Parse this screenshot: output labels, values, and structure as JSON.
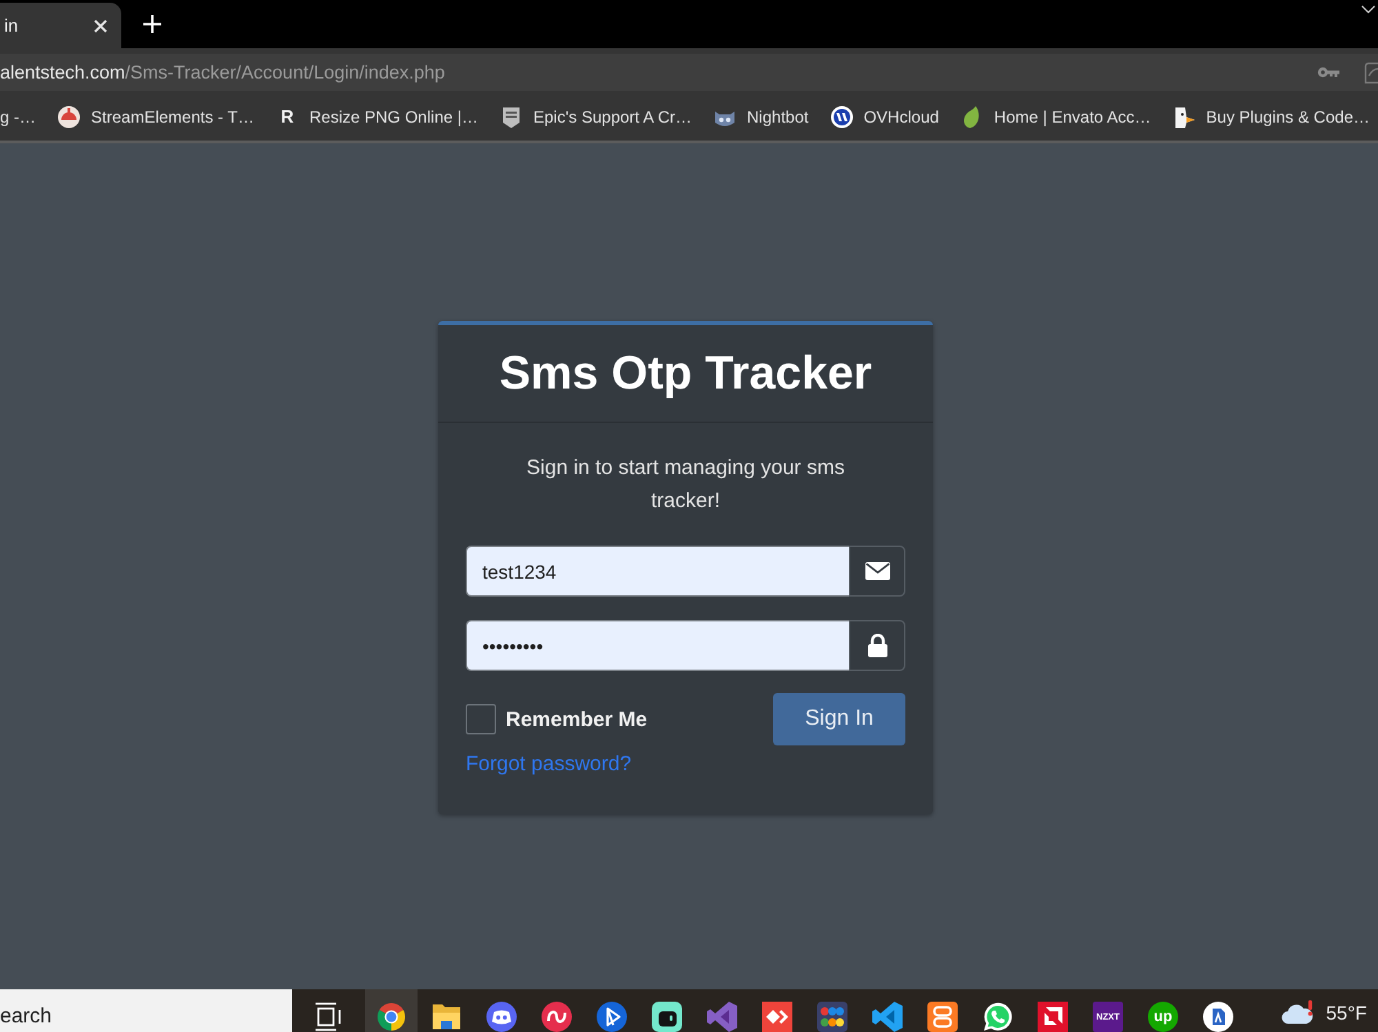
{
  "browser": {
    "tabs": [
      {
        "title": "in",
        "selected": true
      }
    ],
    "address_bar": {
      "host": "alentstech.com",
      "path": "/Sms-Tracker/Account/Login/index.php"
    },
    "bookmarks": [
      {
        "kind": "none",
        "label": "g -…"
      },
      {
        "kind": "dome",
        "label": "StreamElements - T…"
      },
      {
        "kind": "letter",
        "icon_text": "R",
        "label": "Resize PNG Online |…"
      },
      {
        "kind": "shield",
        "label": "Epic's Support A Cr…"
      },
      {
        "kind": "robot",
        "label": "Nightbot"
      },
      {
        "kind": "striped",
        "label": "OVHcloud"
      },
      {
        "kind": "leaf",
        "label": "Home | Envato Acc…"
      },
      {
        "kind": "bird",
        "label": "Buy Plugins & Code…"
      }
    ]
  },
  "login": {
    "title": "Sms Otp Tracker",
    "subtitle": "Sign in to start managing your sms tracker!",
    "fields": [
      {
        "kind": "email",
        "value": "test1234"
      },
      {
        "kind": "password",
        "value": "•••••••••"
      }
    ],
    "remember": {
      "label": "Remember Me",
      "checked": false
    },
    "submit": "Sign In",
    "forgot_link": "Forgot password?"
  },
  "taskbar": {
    "search": {
      "placeholder": "earch"
    },
    "apps": [
      {
        "kind": "task_view",
        "active": false
      },
      {
        "kind": "wheel",
        "active": true
      },
      {
        "kind": "folder",
        "active": false
      },
      {
        "kind": "controller",
        "active": false
      },
      {
        "kind": "loop",
        "active": false
      },
      {
        "kind": "triangle",
        "active": false
      },
      {
        "kind": "robot",
        "active": false
      },
      {
        "kind": "ribbon",
        "active": false
      },
      {
        "kind": "diamond",
        "active": false
      },
      {
        "kind": "dots",
        "active": false
      },
      {
        "kind": "ribbon_blue",
        "active": false
      },
      {
        "kind": "knot",
        "active": false
      },
      {
        "kind": "phone",
        "active": false
      },
      {
        "kind": "corner",
        "active": false
      },
      {
        "kind": "text_tile",
        "text": "NZXT",
        "active": false
      },
      {
        "kind": "text_badge",
        "text": "up",
        "active": false
      },
      {
        "kind": "circle_badge",
        "active": false
      }
    ],
    "weather": {
      "temperature": "55°F"
    }
  }
}
